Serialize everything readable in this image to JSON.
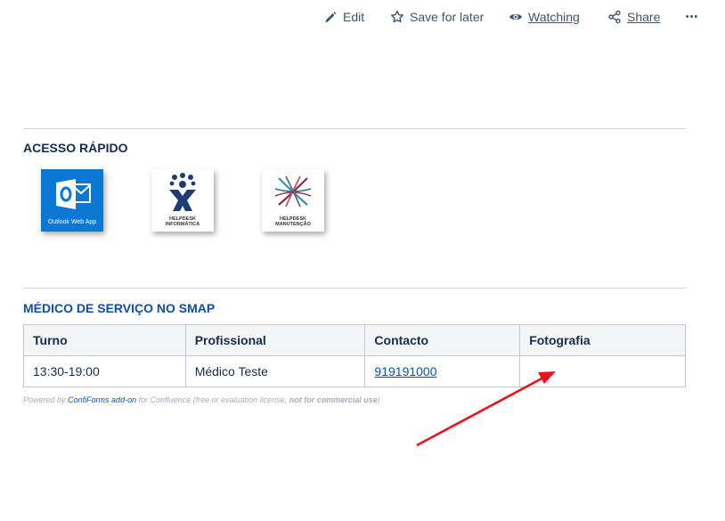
{
  "toolbar": {
    "edit_label": "Edit",
    "save_label": "Save for later",
    "watch_label": "Watching",
    "share_label": "Share",
    "more_label": "•••"
  },
  "quick_access": {
    "title": "ACESSO RÁPIDO",
    "tiles": [
      {
        "caption": "Outlook Web App",
        "icon": "outlook-icon"
      },
      {
        "caption_line1": "HELPDESK",
        "caption_line2": "INFORMÁTICA",
        "icon": "helpdesk-informatica-icon"
      },
      {
        "caption_line1": "HELPDESK",
        "caption_line2": "MANUTENÇÃO",
        "icon": "helpdesk-manutencao-icon"
      }
    ]
  },
  "smap": {
    "title": "MÉDICO DE SERVIÇO NO SMAP",
    "columns": [
      "Turno",
      "Profissional",
      "Contacto",
      "Fotografia"
    ],
    "rows": [
      {
        "turno": "13:30-19:00",
        "profissional": "Médico Teste",
        "contacto": "919191000",
        "fotografia": ""
      }
    ]
  },
  "powered": {
    "prefix": "Powered by",
    "link": "ConfiForms add-on",
    "middle": "for Confluence (free or evaluation license,",
    "bold": "not for commercial use",
    "suffix": ")"
  },
  "colors": {
    "accent": "#0052cc",
    "section_blue": "#0b4fa8",
    "outlook_blue": "#0a78d4",
    "annotation_arrow": "#e8141c"
  }
}
